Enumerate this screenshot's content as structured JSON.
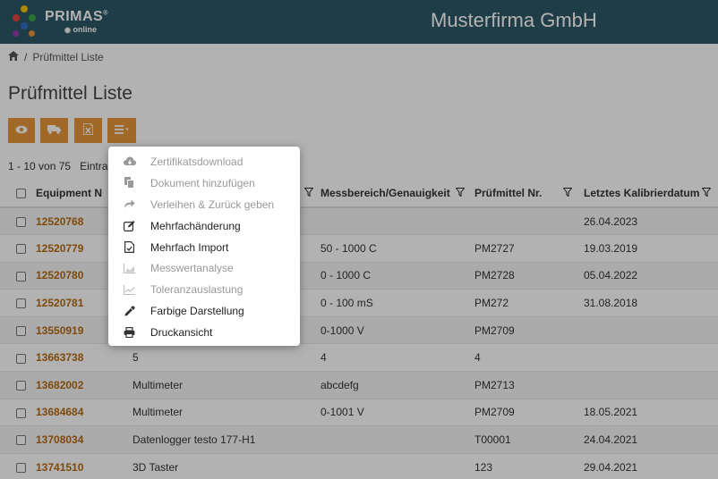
{
  "header": {
    "logo_text": "PRIMAS",
    "logo_reg": "®",
    "logo_sub": "online",
    "company": "Musterfirma GmbH"
  },
  "breadcrumb": {
    "sep": "/",
    "current": "Prüfmittel Liste"
  },
  "page_title": "Prüfmittel Liste",
  "toolbar": {
    "buttons": [
      "eye-icon",
      "truck-icon",
      "excel-icon",
      "menu-icon"
    ],
    "accent": "#e8953a"
  },
  "paging": {
    "range": "1 - 10 von 75",
    "entries_label": "Eintra"
  },
  "menu": {
    "items": [
      {
        "label": "Zertifikatsdownload",
        "icon": "cloud-download-icon",
        "enabled": false
      },
      {
        "label": "Dokument hinzufügen",
        "icon": "copy-icon",
        "enabled": false
      },
      {
        "label": "Verleihen & Zurück geben",
        "icon": "share-icon",
        "enabled": false
      },
      {
        "label": "Mehrfachänderung",
        "icon": "edit-icon",
        "enabled": true
      },
      {
        "label": "Mehrfach Import",
        "icon": "file-import-icon",
        "enabled": true
      },
      {
        "label": "Messwertanalyse",
        "icon": "area-chart-icon",
        "enabled": false
      },
      {
        "label": "Toleranzauslastung",
        "icon": "line-chart-icon",
        "enabled": false
      },
      {
        "label": "Farbige Darstellung",
        "icon": "eyedropper-icon",
        "enabled": true
      },
      {
        "label": "Druckansicht",
        "icon": "print-icon",
        "enabled": true
      }
    ]
  },
  "table": {
    "headers": {
      "equipment": "Equipment N",
      "messbereich": "Messbereich/Genauigkeit",
      "pruefmittel": "Prüfmittel Nr.",
      "kalibrier": "Letztes Kalibrierdatum"
    },
    "rows": [
      {
        "eq": "12520768",
        "bez": "",
        "mb": "",
        "pm": "",
        "date": "26.04.2023"
      },
      {
        "eq": "12520779",
        "bez": "",
        "mb": "50 - 1000 C",
        "pm": "PM2727",
        "date": "19.03.2019"
      },
      {
        "eq": "12520780",
        "bez": "",
        "mb": "0 - 1000 C",
        "pm": "PM2728",
        "date": "05.04.2022"
      },
      {
        "eq": "12520781",
        "bez": "",
        "mb": "0 - 100 mS",
        "pm": "PM272",
        "date": "31.08.2018"
      },
      {
        "eq": "13550919",
        "bez": "",
        "mb": "0-1000 V",
        "pm": "PM2709",
        "date": ""
      },
      {
        "eq": "13663738",
        "bez": "5",
        "mb": "4",
        "pm": "4",
        "date": ""
      },
      {
        "eq": "13682002",
        "bez": "Multimeter",
        "mb": "abcdefg",
        "pm": "PM2713",
        "date": ""
      },
      {
        "eq": "13684684",
        "bez": "Multimeter",
        "mb": "0-1001 V",
        "pm": "PM2709",
        "date": "18.05.2021"
      },
      {
        "eq": "13708034",
        "bez": "Datenlogger testo 177-H1",
        "mb": "",
        "pm": "T00001",
        "date": "24.04.2021"
      },
      {
        "eq": "13741510",
        "bez": "3D Taster",
        "mb": "",
        "pm": "123",
        "date": "29.04.2021"
      }
    ]
  }
}
